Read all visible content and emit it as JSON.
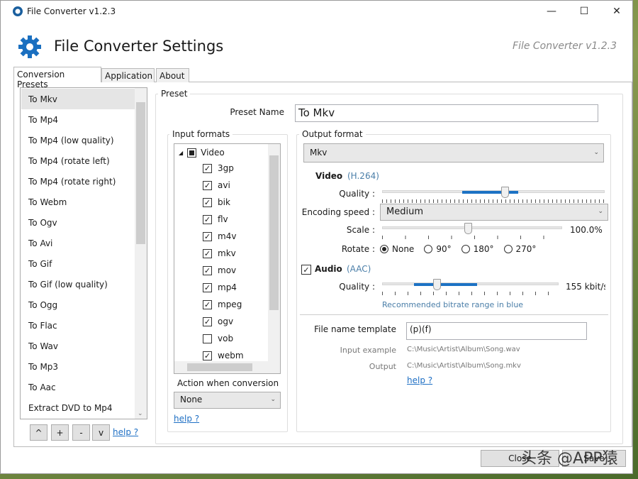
{
  "window": {
    "title": "File Converter v1.2.3",
    "minimize": "—",
    "maximize": "☐",
    "close": "✕"
  },
  "header": {
    "title": "File Converter Settings",
    "version": "File Converter v1.2.3"
  },
  "tabs": [
    {
      "label": "Conversion Presets",
      "active": true
    },
    {
      "label": "Application"
    },
    {
      "label": "About"
    }
  ],
  "presets": {
    "items": [
      "To Mkv",
      "To Mp4",
      "To Mp4 (low quality)",
      "To Mp4 (rotate left)",
      "To Mp4 (rotate right)",
      "To Webm",
      "To Ogv",
      "To Avi",
      "To Gif",
      "To Gif (low quality)",
      "To Ogg",
      "To Flac",
      "To Wav",
      "To Mp3",
      "To Aac",
      "Extract DVD to Mp4"
    ],
    "selected": "To Mkv",
    "buttons": [
      "^",
      "+",
      "-",
      "v"
    ],
    "help": "help ?"
  },
  "preset": {
    "group_label": "Preset",
    "name_label": "Preset Name",
    "name_value": "To Mkv"
  },
  "input_formats": {
    "label": "Input formats",
    "root": "Video",
    "items": [
      {
        "name": "3gp",
        "checked": true
      },
      {
        "name": "avi",
        "checked": true
      },
      {
        "name": "bik",
        "checked": true
      },
      {
        "name": "flv",
        "checked": true
      },
      {
        "name": "m4v",
        "checked": true
      },
      {
        "name": "mkv",
        "checked": true
      },
      {
        "name": "mov",
        "checked": true
      },
      {
        "name": "mp4",
        "checked": true
      },
      {
        "name": "mpeg",
        "checked": true
      },
      {
        "name": "ogv",
        "checked": true
      },
      {
        "name": "vob",
        "checked": false
      },
      {
        "name": "webm",
        "checked": true
      }
    ],
    "action_label": "Action when conversion",
    "action_value": "None",
    "help": "help ?"
  },
  "output": {
    "label": "Output format",
    "format": "Mkv",
    "video": {
      "label": "Video",
      "codec": "(H.264)",
      "quality_label": "Quality :",
      "quality_value": 0.55,
      "quality_range": [
        0.36,
        0.61
      ],
      "speed_label": "Encoding speed :",
      "speed_value": "Medium",
      "scale_label": "Scale :",
      "scale_value": "100.0%",
      "rotate_label": "Rotate :",
      "rotate_options": [
        "None",
        "90°",
        "180°",
        "270°"
      ],
      "rotate_selected": "None"
    },
    "audio": {
      "label": "Audio",
      "codec": "(AAC)",
      "enabled": true,
      "quality_label": "Quality :",
      "quality_value": "155 kbit/s",
      "recommended": "Recommended bitrate range in blue"
    },
    "template_label": "File name template",
    "template_value": "(p)(f)",
    "input_example_label": "Input example",
    "input_example": "C:\\Music\\Artist\\Album\\Song.wav",
    "output_label": "Output",
    "output_example": "C:\\Music\\Artist\\Album\\Song.mkv",
    "help": "help ?"
  },
  "footer": {
    "close": "Close",
    "save": "Save"
  },
  "watermark": "头条 @APP猿",
  "colors": {
    "accent": "#1c72c4",
    "gear": "#1a6fc0"
  }
}
